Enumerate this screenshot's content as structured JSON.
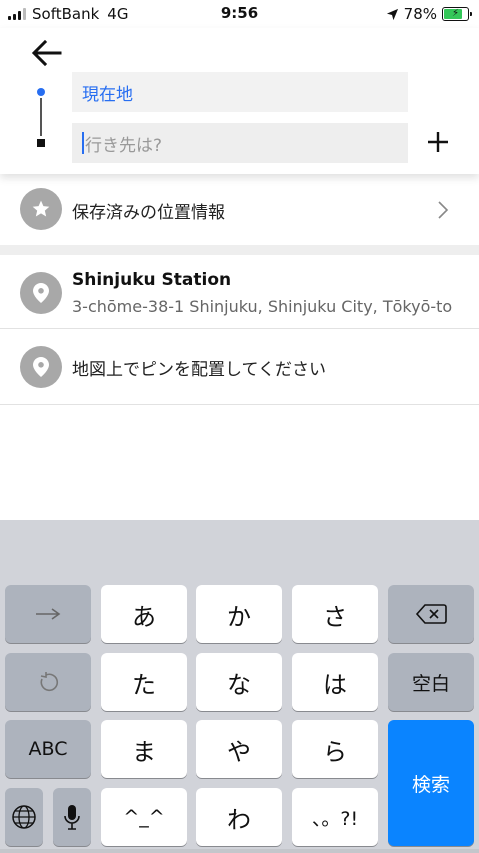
{
  "status_bar": {
    "carrier": "SoftBank",
    "network": "4G",
    "time": "9:56",
    "battery_percent": "78%",
    "battery_level": 0.78,
    "location_icon": "location-arrow-icon"
  },
  "route": {
    "from_value": "現在地",
    "to_placeholder": "行き先は?"
  },
  "saved_places": {
    "label": "保存済みの位置情報",
    "icon": "star-icon"
  },
  "suggestions": [
    {
      "title": "Shinjuku Station",
      "subtitle": "3-chōme-38-1 Shinjuku, Shinjuku City, Tōkyō-to",
      "icon": "location-pin-icon"
    }
  ],
  "set_pin": {
    "label": "地図上でピンを配置してください",
    "icon": "location-pin-icon"
  },
  "keyboard": {
    "row1": [
      "→",
      "あ",
      "か",
      "さ",
      "⌫"
    ],
    "row2": [
      "↺",
      "た",
      "な",
      "は",
      "空白"
    ],
    "row3": [
      "ABC",
      "ま",
      "や",
      "ら"
    ],
    "row4": [
      "🌐",
      "🎤",
      "^_^",
      "わ",
      "、。?!"
    ],
    "search_label": "検索"
  },
  "colors": {
    "accent": "#276ef1",
    "keyboard_bg": "#d1d3d9",
    "search_key": "#0a84ff",
    "icon_gray": "#a8a8a8"
  }
}
